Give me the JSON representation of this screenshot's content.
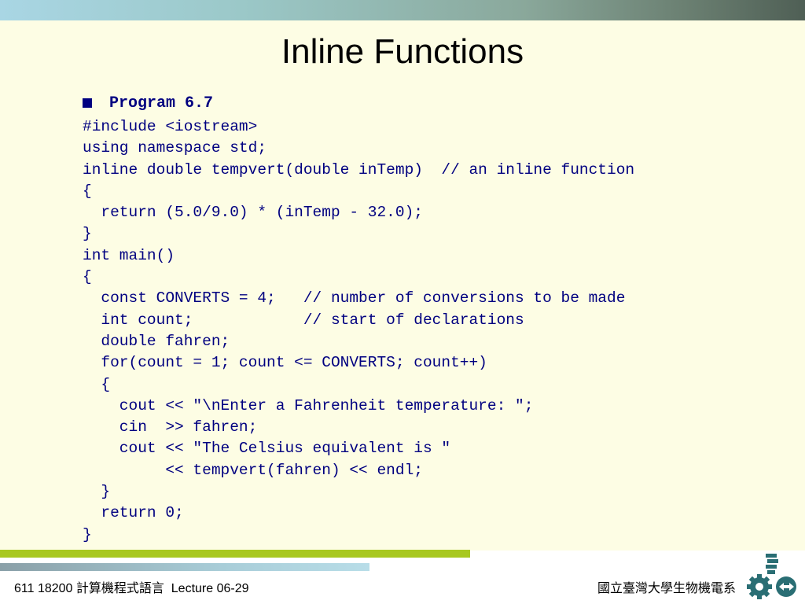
{
  "slide": {
    "title": "Inline Functions",
    "program_label": "Program 6.7",
    "code_lines": [
      "#include <iostream>",
      "using namespace std;",
      "inline double tempvert(double inTemp)  // an inline function",
      "{",
      "  return (5.0/9.0) * (inTemp - 32.0);",
      "}",
      "int main()",
      "{",
      "  const CONVERTS = 4;   // number of conversions to be made",
      "  int count;            // start of declarations",
      "  double fahren;",
      "  for(count = 1; count <= CONVERTS; count++)",
      "  {",
      "    cout << \"\\nEnter a Fahrenheit temperature: \";",
      "    cin  >> fahren;",
      "    cout << \"The Celsius equivalent is \"",
      "         << tempvert(fahren) << endl;",
      "  }",
      "  return 0;",
      "}"
    ]
  },
  "footer": {
    "left": "611 18200 計算機程式語言  Lecture 06-29",
    "right": "國立臺灣大學生物機電系"
  },
  "colors": {
    "code_text": "#000080",
    "accent_green": "#a8c820",
    "background": "#fdfde4"
  },
  "icons": [
    "square-bullet-icon",
    "department-logo-icon"
  ]
}
